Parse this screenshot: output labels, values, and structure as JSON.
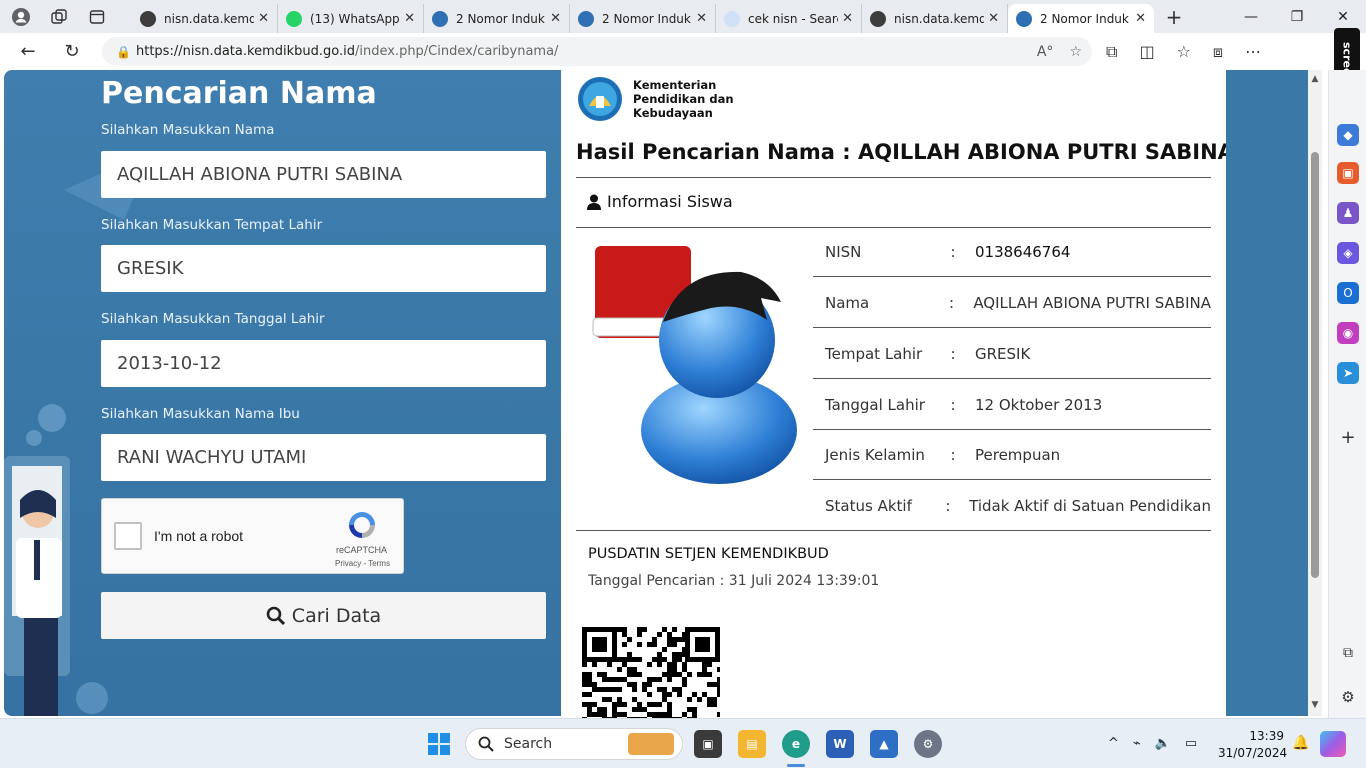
{
  "browser": {
    "tabs": [
      {
        "title": "nisn.data.kemd",
        "fav": "#3c3c3c"
      },
      {
        "title": "(13) WhatsApp",
        "fav": "#25d366"
      },
      {
        "title": "2 Nomor Induk",
        "fav": "#2f6fb3"
      },
      {
        "title": "2 Nomor Induk",
        "fav": "#2f6fb3"
      },
      {
        "title": "cek nisn - Searc",
        "fav": "#1a73e8"
      },
      {
        "title": "nisn.data.kemd",
        "fav": "#3c3c3c"
      },
      {
        "title": "2 Nomor Induk",
        "fav": "#2f6fb3"
      }
    ],
    "url_host": "https://nisn.data.kemdikbud.go.id",
    "url_path": "/index.php/Cindex/caribynama/",
    "side_badge": "screenrec"
  },
  "form": {
    "title": "Pencarian Nama",
    "name_label": "Silahkan Masukkan Nama",
    "name_value": "AQILLAH ABIONA PUTRI SABINA",
    "birthplace_label": "Silahkan Masukkan Tempat Lahir",
    "birthplace_value": "GRESIK",
    "birthdate_label": "Silahkan Masukkan Tanggal Lahir",
    "birthdate_value": "2013-10-12",
    "mother_label": "Silahkan Masukkan Nama Ibu",
    "mother_value": "RANI WACHYU UTAMI",
    "captcha_label": "I'm not a robot",
    "captcha_brand": "reCAPTCHA",
    "captcha_terms": "Privacy - Terms",
    "submit_label": "Cari Data"
  },
  "result": {
    "ministry": "Kementerian Pendidikan dan Kebudayaan",
    "title": "Hasil Pencarian Nama : AQILLAH ABIONA PUTRI SABINA",
    "section": "Informasi Siswa",
    "rows": [
      {
        "key": "NISN",
        "sep": ":",
        "value": "0138646764"
      },
      {
        "key": "Nama",
        "sep": ":",
        "value": "AQILLAH ABIONA PUTRI SABINA"
      },
      {
        "key": "Tempat Lahir",
        "sep": ":",
        "value": "GRESIK"
      },
      {
        "key": "Tanggal Lahir",
        "sep": ":",
        "value": "12 Oktober 2013"
      },
      {
        "key": "Jenis Kelamin",
        "sep": ":",
        "value": "Perempuan"
      },
      {
        "key": "Status Aktif",
        "sep": ":",
        "value": "Tidak Aktif di Satuan Pendidikan"
      }
    ],
    "org": "PUSDATIN SETJEN KEMENDIKBUD",
    "search_date": "Tanggal Pencarian : 31 Juli 2024 13:39:01"
  },
  "taskbar": {
    "search_placeholder": "Search",
    "time": "13:39",
    "date": "31/07/2024"
  }
}
